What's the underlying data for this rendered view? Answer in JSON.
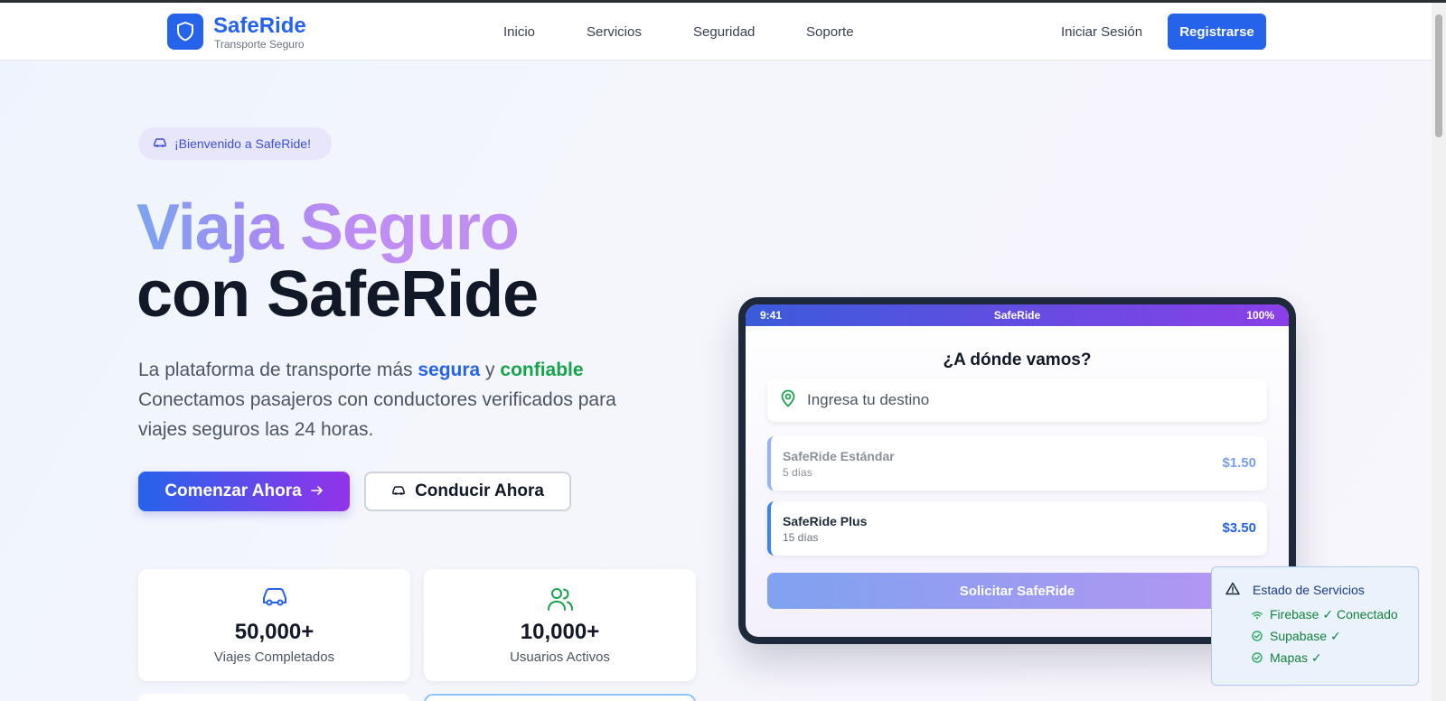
{
  "header": {
    "brand_name": "SafeRide",
    "brand_tagline": "Transporte Seguro",
    "nav": [
      "Inicio",
      "Servicios",
      "Seguridad",
      "Soporte"
    ],
    "login_label": "Iniciar Sesión",
    "register_label": "Registrarse"
  },
  "hero": {
    "welcome_badge": "¡Bienvenido a SafeRide!",
    "title_line1": "Viaja Seguro",
    "title_line2": "con SafeRide",
    "desc_prefix": "La plataforma de transporte más ",
    "desc_highlight1": "segura",
    "desc_mid": " y ",
    "desc_highlight2": "confiable",
    "desc_rest": "Conectamos pasajeros con conductores verificados para viajes seguros las 24 horas.",
    "cta_primary": "Comenzar Ahora",
    "cta_secondary": "Conducir Ahora"
  },
  "stats": [
    {
      "value": "50,000+",
      "label": "Viajes Completados",
      "icon": "car-icon"
    },
    {
      "value": "10,000+",
      "label": "Usuarios Activos",
      "icon": "users-icon"
    }
  ],
  "phone": {
    "time": "9:41",
    "app_name": "SafeRide",
    "battery": "100%",
    "title": "¿A dónde vamos?",
    "destination_placeholder": "Ingresa tu destino",
    "options": [
      {
        "name": "SafeRide Estándar",
        "sub": "5 días",
        "price": "$1.50"
      },
      {
        "name": "SafeRide Plus",
        "sub": "15 días",
        "price": "$3.50"
      }
    ],
    "request_label": "Solicitar SafeRide"
  },
  "service_status": {
    "title": "Estado de Servicios",
    "items": [
      "Firebase ✓ Conectado",
      "Supabase ✓",
      "Mapas ✓"
    ]
  },
  "colors": {
    "accent": "#2563eb",
    "success": "#16a34a",
    "gradient_end": "#9333ea"
  }
}
